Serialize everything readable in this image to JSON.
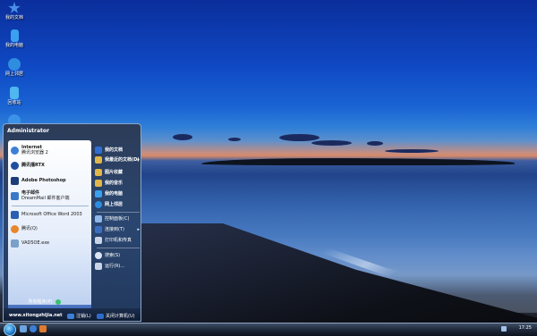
{
  "desktop": {
    "icons": [
      {
        "label": "我的文档",
        "icon": "star-document-icon",
        "color": "#4a8fe6"
      },
      {
        "label": "我的电脑",
        "icon": "computer-icon",
        "color": "#3aa0f0"
      },
      {
        "label": "网上邻居",
        "icon": "network-globe-icon",
        "color": "#2f8de0"
      },
      {
        "label": "回收站",
        "icon": "recycle-bin-icon",
        "color": "#4fb6f0"
      },
      {
        "label": "",
        "icon": "internet-explorer-icon",
        "color": "#3b92e8"
      }
    ]
  },
  "start_menu": {
    "user": "Administrator",
    "pinned": [
      {
        "title": "Internet",
        "subtitle": "腾讯浏览器 2",
        "icon": "browser-icon",
        "color": "#3d7fd6"
      },
      {
        "title": "腾讯播RTX",
        "subtitle": "",
        "icon": "rtx-messenger-icon",
        "color": "#1f4f9e"
      },
      {
        "title": "Adobe Photoshop",
        "subtitle": "",
        "icon": "photoshop-icon",
        "color": "#1d3c7a"
      },
      {
        "title": "电子邮件",
        "subtitle": "DreamMail 邮件客户端",
        "icon": "email-icon",
        "color": "#3a79c9"
      }
    ],
    "recent": [
      {
        "title": "Microsoft Office Word 2003",
        "icon": "word-icon",
        "color": "#2c5fb3"
      },
      {
        "title": "腾讯(Q)",
        "icon": "qq-penguin-icon",
        "color": "#e8862a"
      },
      {
        "title": "VAD5OE.exe",
        "icon": "app-icon",
        "color": "#7aa1c8"
      }
    ],
    "all_programs": "所有程序(P)",
    "right": [
      {
        "label": "我的文档",
        "icon": "star-document-icon",
        "color": "#2f6fd0",
        "bold": true,
        "arrow": false
      },
      {
        "label": "我最近的文档(D)",
        "icon": "recent-docs-icon",
        "color": "#e1b749",
        "bold": true,
        "arrow": true
      },
      {
        "label": "图片收藏",
        "icon": "pictures-folder-icon",
        "color": "#e1b749",
        "bold": true,
        "arrow": false
      },
      {
        "label": "我的音乐",
        "icon": "music-folder-icon",
        "color": "#e1b749",
        "bold": true,
        "arrow": false
      },
      {
        "label": "我的电脑",
        "icon": "computer-icon",
        "color": "#3aa0f0",
        "bold": true,
        "arrow": false
      },
      {
        "label": "网上邻居",
        "icon": "network-globe-icon",
        "color": "#2f8de0",
        "bold": true,
        "arrow": false
      },
      {
        "label": "控制面板(C)",
        "icon": "control-panel-icon",
        "color": "#8fb8e8",
        "bold": false,
        "arrow": false
      },
      {
        "label": "连接到(T)",
        "icon": "connect-icon",
        "color": "#3a6fc0",
        "bold": false,
        "arrow": true
      },
      {
        "label": "打印机和传真",
        "icon": "printer-icon",
        "color": "#c9d4e6",
        "bold": false,
        "arrow": false
      },
      {
        "label": "搜索(S)",
        "icon": "search-icon",
        "color": "#dbe6f5",
        "bold": false,
        "arrow": false
      },
      {
        "label": "运行(R)...",
        "icon": "run-icon",
        "color": "#c9d4e6",
        "bold": false,
        "arrow": false
      }
    ],
    "footer": {
      "site": "www.xitongzhijia.net",
      "logoff": "注销(L)",
      "shutdown": "关闭计算机(U)"
    }
  },
  "taskbar": {
    "time": "17:25"
  }
}
